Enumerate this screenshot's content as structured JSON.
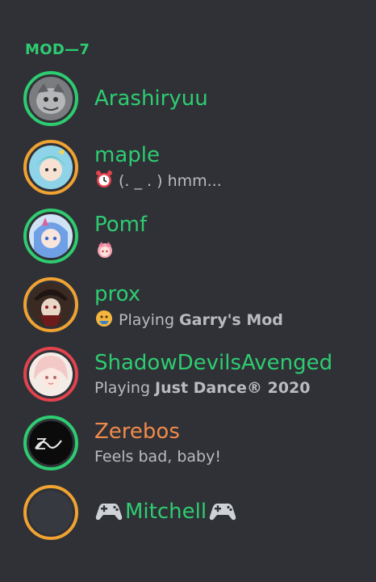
{
  "header": {
    "label": "MOD—7"
  },
  "colors": {
    "online": "#2ecc71",
    "idle": "#f0a232",
    "dnd": "#e2434e",
    "name_green": "#2ecc71",
    "name_orange": "#f08a4b",
    "status_text": "#b9bbbe",
    "background": "#2f3136"
  },
  "members": [
    {
      "name": "Arashiryuu",
      "presence": "online",
      "status": ""
    },
    {
      "name": "maple",
      "presence": "idle",
      "status_icon": "alarm-clock-icon",
      "status": "(. _ . ) hmm..."
    },
    {
      "name": "Pomf",
      "presence": "online",
      "status_icon": "anime-girl-emoji-icon",
      "status": ""
    },
    {
      "name": "prox",
      "presence": "idle",
      "status_icon": "game-emoji-icon",
      "status_prefix": "Playing ",
      "status_bold": "Garry's Mod"
    },
    {
      "name": "ShadowDevilsAvenged",
      "presence": "dnd",
      "status_prefix": "Playing ",
      "status_bold": "Just Dance® 2020"
    },
    {
      "name": "Zerebos",
      "presence": "online",
      "status": "Feels bad, baby!"
    },
    {
      "name": "Mitchell",
      "presence": "idle",
      "name_prefix_icon": "gamepad-icon",
      "name_suffix_icon": "gamepad-icon"
    }
  ]
}
